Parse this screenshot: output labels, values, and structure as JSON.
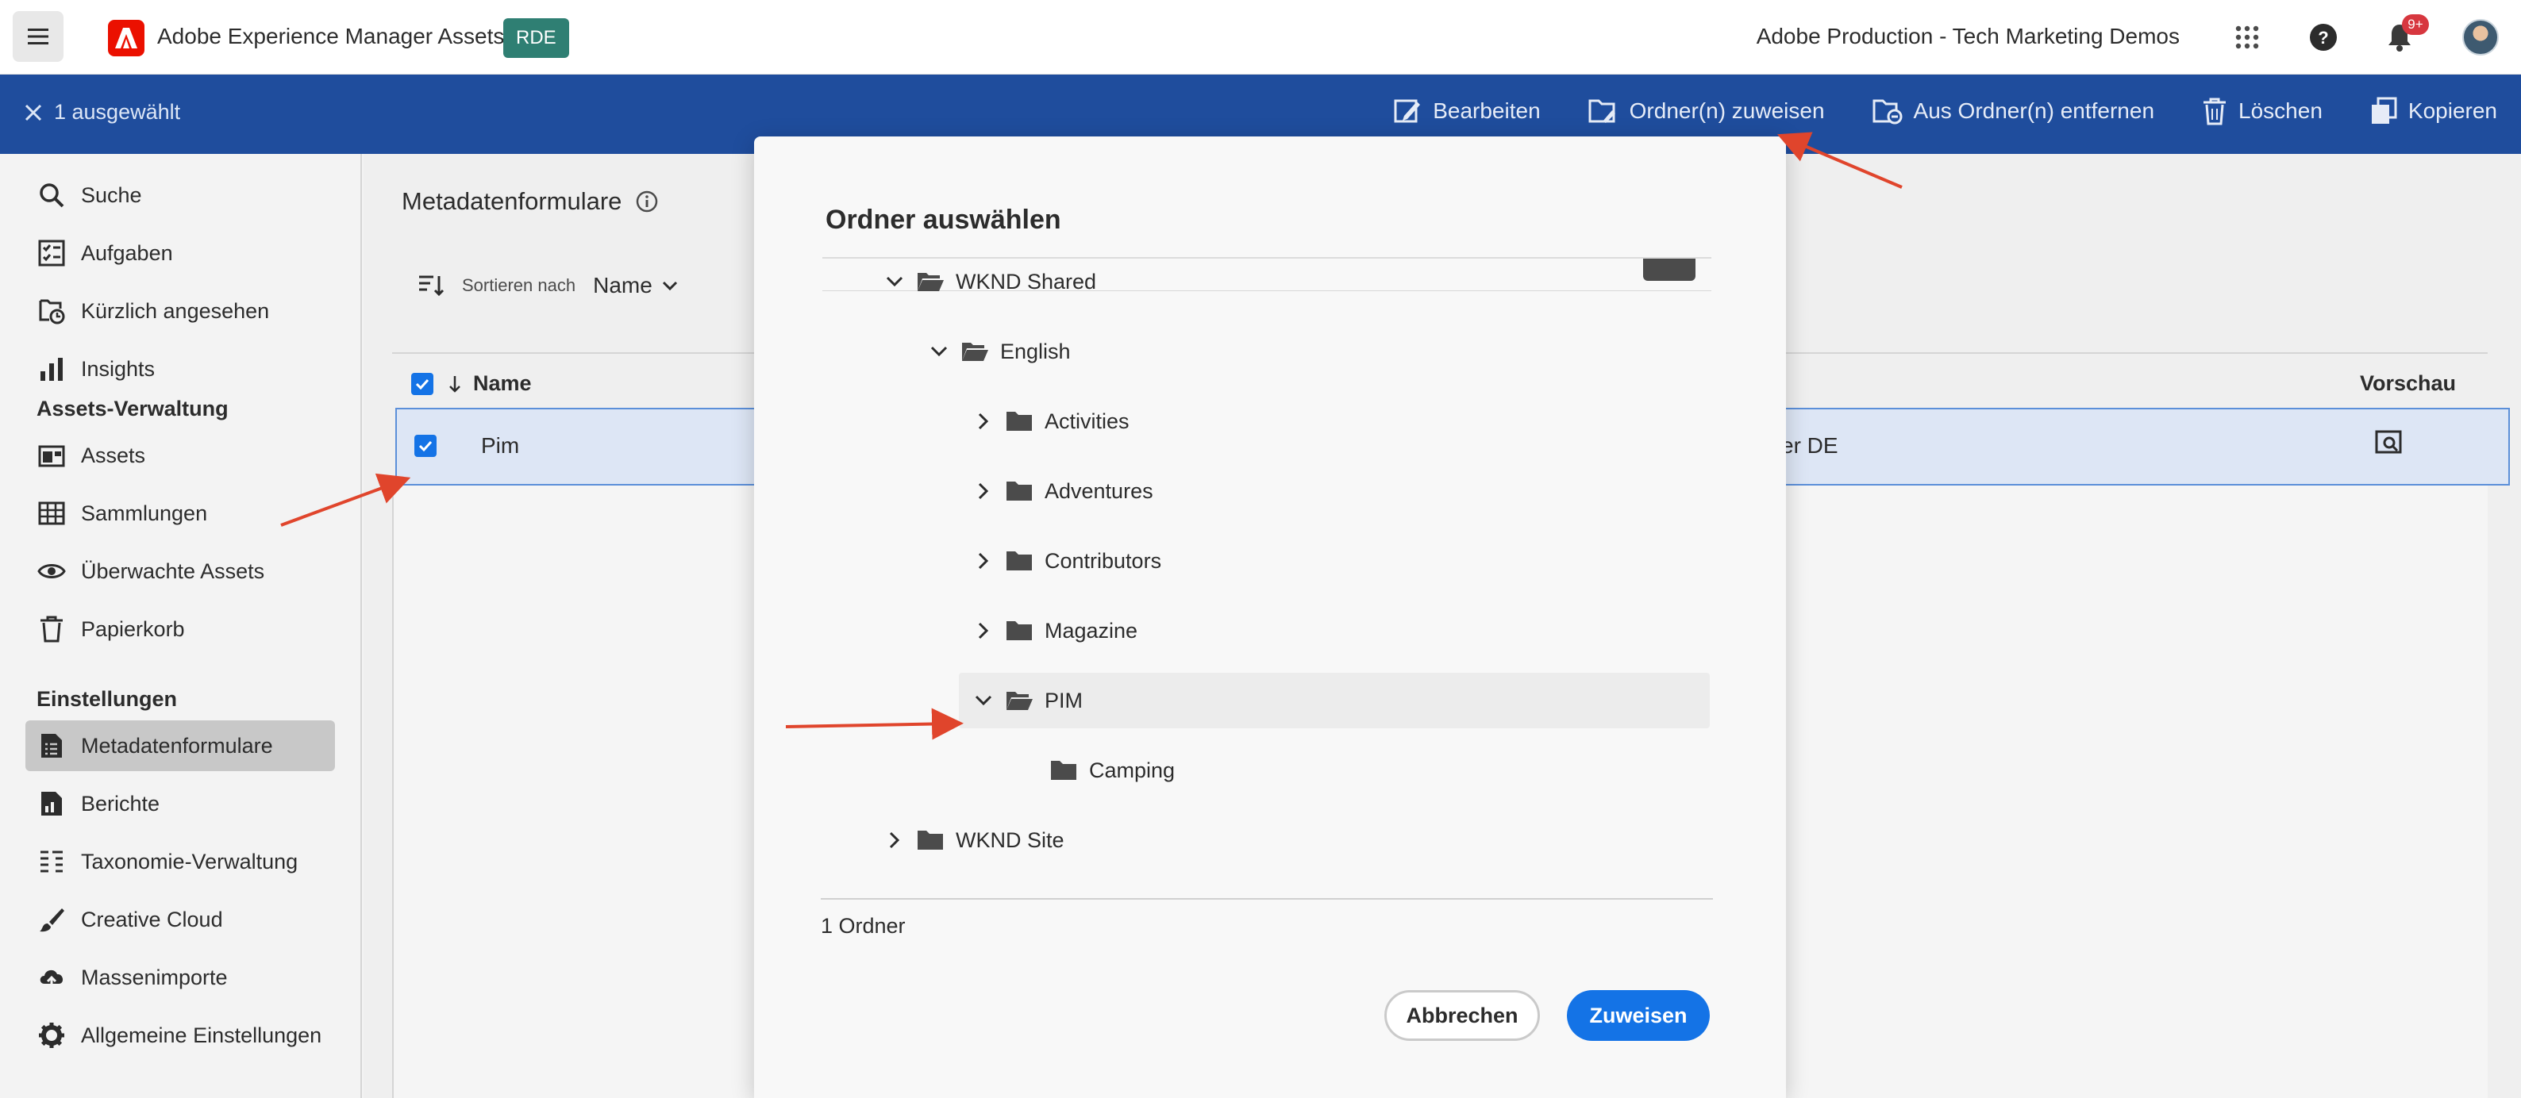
{
  "header": {
    "app_title": "Adobe Experience Manager Assets",
    "env_badge": "RDE",
    "org_name": "Adobe Production - Tech Marketing Demos",
    "notification_count": "9+"
  },
  "action_bar": {
    "selection_label": "1 ausgewählt",
    "actions": [
      {
        "label": "Bearbeiten",
        "icon": "edit-icon"
      },
      {
        "label": "Ordner(n) zuweisen",
        "icon": "folder-assign-icon"
      },
      {
        "label": "Aus Ordner(n) entfernen",
        "icon": "folder-remove-icon"
      },
      {
        "label": "Löschen",
        "icon": "delete-icon"
      },
      {
        "label": "Kopieren",
        "icon": "copy-icon"
      }
    ]
  },
  "sidebar": {
    "items_top": [
      {
        "label": "Suche",
        "icon": "search-icon"
      },
      {
        "label": "Aufgaben",
        "icon": "tasks-icon"
      },
      {
        "label": "Kürzlich angesehen",
        "icon": "recent-icon"
      },
      {
        "label": "Insights",
        "icon": "insights-icon"
      }
    ],
    "section_assets": "Assets-Verwaltung",
    "items_assets": [
      {
        "label": "Assets",
        "icon": "assets-icon"
      },
      {
        "label": "Sammlungen",
        "icon": "collections-icon"
      },
      {
        "label": "Überwachte Assets",
        "icon": "eye-icon"
      },
      {
        "label": "Papierkorb",
        "icon": "trash-icon"
      }
    ],
    "section_settings": "Einstellungen",
    "items_settings": [
      {
        "label": "Metadatenformulare",
        "icon": "metadata-forms-icon",
        "active": true
      },
      {
        "label": "Berichte",
        "icon": "reports-icon"
      },
      {
        "label": "Taxonomie-Verwaltung",
        "icon": "taxonomy-icon"
      },
      {
        "label": "Creative Cloud",
        "icon": "brush-icon"
      },
      {
        "label": "Massenimporte",
        "icon": "cloud-upload-icon"
      },
      {
        "label": "Allgemeine Einstellungen",
        "icon": "gear-icon"
      }
    ]
  },
  "main": {
    "page_title": "Metadatenformulare",
    "sort_label": "Sortieren nach",
    "sort_value": "Name",
    "table": {
      "col_name": "Name",
      "col_preview": "Vorschau",
      "rows": [
        {
          "name": "Pim",
          "description_fragment": "ser DE",
          "selected": true
        }
      ]
    }
  },
  "dialog": {
    "title": "Ordner auswählen",
    "tree": [
      {
        "label": "WKND Shared",
        "expanded": true
      },
      {
        "label": "English",
        "expanded": true
      },
      {
        "label": "Activities",
        "expanded": false
      },
      {
        "label": "Adventures",
        "expanded": false
      },
      {
        "label": "Contributors",
        "expanded": false
      },
      {
        "label": "Magazine",
        "expanded": false
      },
      {
        "label": "PIM",
        "expanded": true,
        "selected": true
      },
      {
        "label": "Camping",
        "expanded": false
      },
      {
        "label": "WKND Site",
        "expanded": false
      }
    ],
    "folder_count": "1 Ordner",
    "cancel_label": "Abbrechen",
    "assign_label": "Zuweisen"
  },
  "colors": {
    "action_bar": "#1f4d9d",
    "primary_button": "#1473e6",
    "rde_badge": "#2f7f73",
    "annotation_arrow": "#e0452c"
  }
}
